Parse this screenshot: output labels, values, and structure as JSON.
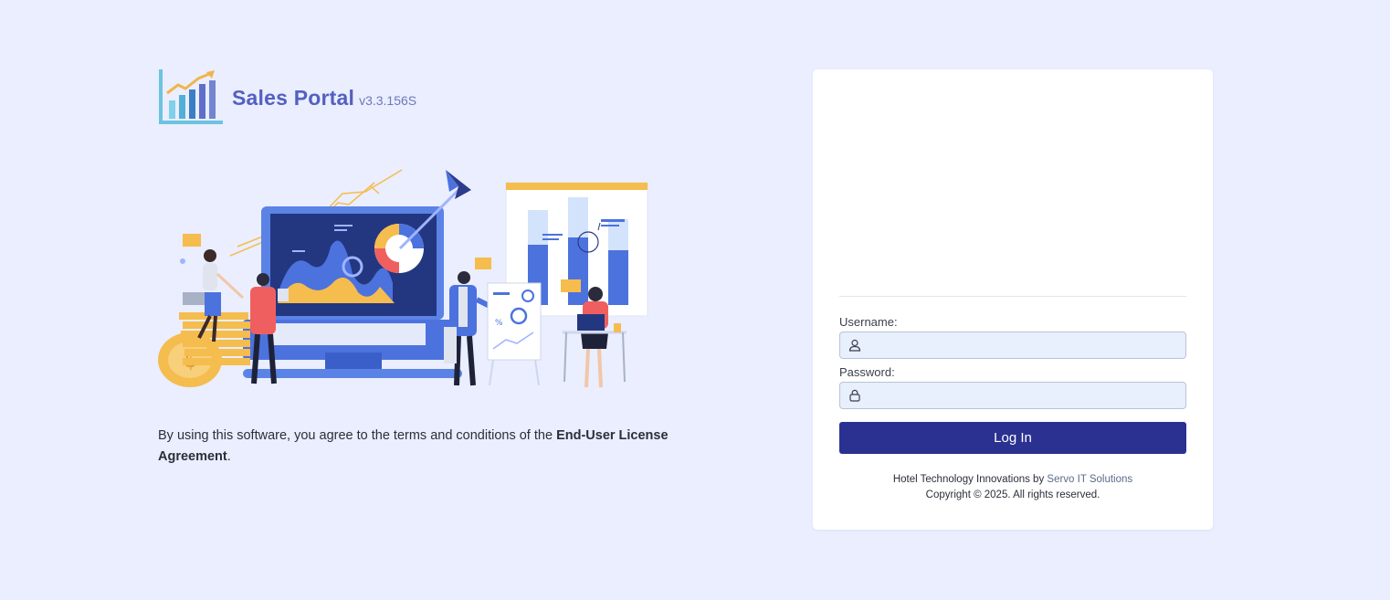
{
  "brand": {
    "title": "Sales Portal",
    "version": "v3.3.156S",
    "logo_icon": "bar-chart-growth-icon",
    "accent_color": "#5360c2"
  },
  "illustration": {
    "name": "business-analytics-illustration",
    "callout_symbol": "%"
  },
  "license": {
    "prefix": "By using this software, you agree to the terms and conditions of the ",
    "link_text": "End-User License Agreement",
    "suffix": "."
  },
  "login": {
    "username_label": "Username:",
    "username_value": "",
    "username_icon": "user-icon",
    "password_label": "Password:",
    "password_value": "",
    "password_icon": "lock-icon",
    "button_label": "Log In",
    "button_color": "#2b3190"
  },
  "footer": {
    "credit_prefix": "Hotel Technology Innovations by ",
    "credit_link": "Servo IT Solutions",
    "copyright": "Copyright © 2025. All rights reserved."
  }
}
